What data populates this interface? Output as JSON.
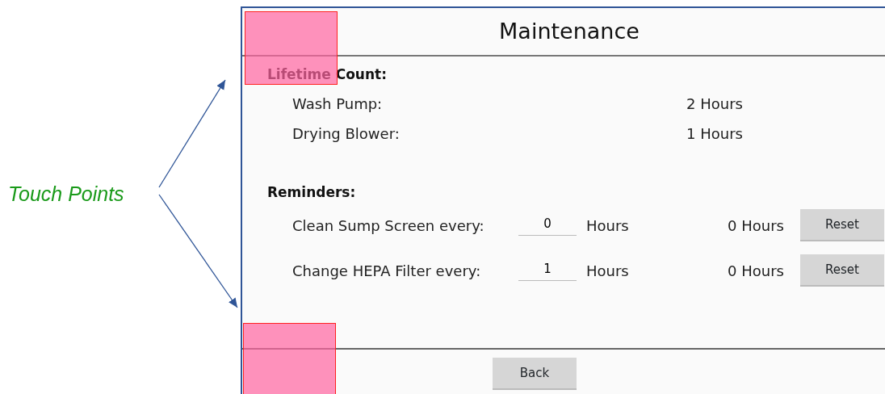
{
  "annotation": {
    "label": "Touch Points"
  },
  "screen": {
    "title": "Maintenance",
    "sections": [
      {
        "heading": "Lifetime Count:",
        "rows": [
          {
            "kind": "reading",
            "label": "Wash Pump:",
            "value": "2 Hours"
          },
          {
            "kind": "reading",
            "label": "Drying Blower:",
            "value": "1 Hours"
          }
        ]
      },
      {
        "heading": "Reminders:",
        "rows": [
          {
            "kind": "reminder",
            "label": "Clean Sump Screen every:",
            "input": "0",
            "unit": "Hours",
            "value": "0 Hours",
            "button": "Reset"
          },
          {
            "kind": "reminder",
            "label": "Change HEPA Filter every:",
            "input": "1",
            "unit": "Hours",
            "value": "0 Hours",
            "button": "Reset"
          }
        ]
      }
    ],
    "back_button": "Back"
  }
}
